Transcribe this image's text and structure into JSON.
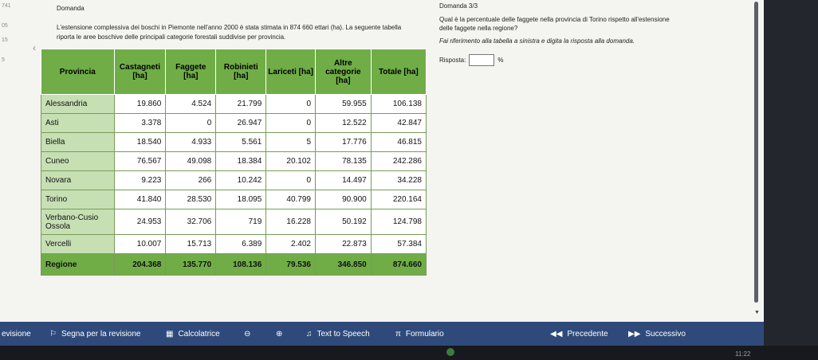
{
  "header": {
    "title": "Domanda",
    "question_number": "Domanda 3/3"
  },
  "gutter": [
    "741",
    "05",
    "15",
    "5"
  ],
  "question": {
    "text": "L'estensione complessiva dei boschi in Piemonte nell'anno 2000 è stata stimata in 874 660 ettari (ha). La seguente tabella riporta le aree boschive delle principali categorie forestali suddivise per provincia.",
    "right_question": "Qual è la percentuale delle faggete nella provincia di Torino rispetto all'estensione delle faggete nella regione?",
    "instruction": "Fai riferimento alla tabella a sinistra e digita la risposta alla domanda.",
    "answer_label": "Risposta:",
    "answer_value": "",
    "answer_unit": "%"
  },
  "table": {
    "headers": [
      "Provincia",
      "Castagneti [ha]",
      "Faggete [ha]",
      "Robinieti [ha]",
      "Lariceti [ha]",
      "Altre categorie [ha]",
      "Totale [ha]"
    ],
    "rows": [
      [
        "Alessandria",
        "19.860",
        "4.524",
        "21.799",
        "0",
        "59.955",
        "106.138"
      ],
      [
        "Asti",
        "3.378",
        "0",
        "26.947",
        "0",
        "12.522",
        "42.847"
      ],
      [
        "Biella",
        "18.540",
        "4.933",
        "5.561",
        "5",
        "17.776",
        "46.815"
      ],
      [
        "Cuneo",
        "76.567",
        "49.098",
        "18.384",
        "20.102",
        "78.135",
        "242.286"
      ],
      [
        "Novara",
        "9.223",
        "266",
        "10.242",
        "0",
        "14.497",
        "34.228"
      ],
      [
        "Torino",
        "41.840",
        "28.530",
        "18.095",
        "40.799",
        "90.900",
        "220.164"
      ],
      [
        "Verbano-Cusio Ossola",
        "24.953",
        "32.706",
        "719",
        "16.228",
        "50.192",
        "124.798"
      ],
      [
        "Vercelli",
        "10.007",
        "15.713",
        "6.389",
        "2.402",
        "22.873",
        "57.384"
      ]
    ],
    "total": [
      "Regione",
      "204.368",
      "135.770",
      "108.136",
      "79.536",
      "346.850",
      "874.660"
    ]
  },
  "toolbar": {
    "revision": "evisione",
    "flag": "Segna per la revisione",
    "calculator": "Calcolatrice",
    "tts": "Text to Speech",
    "formulary": "Formulario",
    "prev": "Precedente",
    "next": "Successivo"
  },
  "status": {
    "clock": "11:22"
  }
}
